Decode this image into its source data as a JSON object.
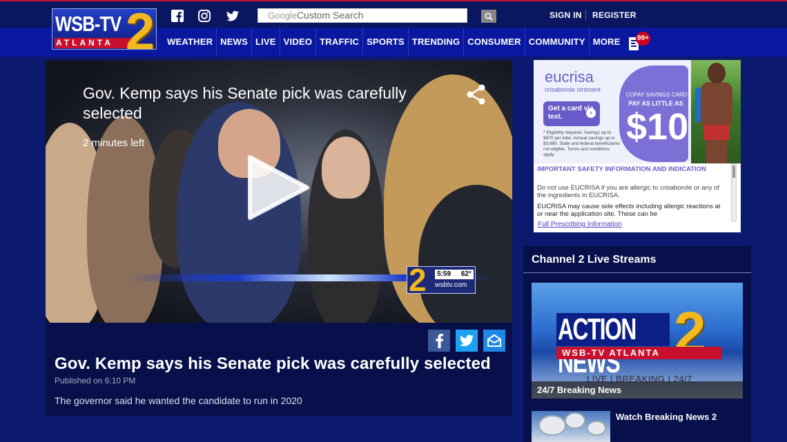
{
  "header": {
    "logo": {
      "name": "WSB-TV",
      "number": "2",
      "city": "ATLANTA"
    },
    "social": [
      "facebook-icon",
      "instagram-icon",
      "twitter-icon"
    ],
    "search": {
      "brand": "Google",
      "placeholder": "Custom Search"
    },
    "signin_label": "SIGN IN",
    "register_label": "REGISTER",
    "nav": [
      "WEATHER",
      "NEWS",
      "LIVE",
      "VIDEO",
      "TRAFFIC",
      "SPORTS",
      "TRENDING",
      "CONSUMER",
      "COMMUNITY",
      "MORE"
    ],
    "notifications_badge": "99+"
  },
  "video": {
    "title": "Gov. Kemp says his Senate pick was carefully selected",
    "time_left": "2 minutes left",
    "bug": {
      "time": "5:59",
      "temp": "62°",
      "site": "wsbtv.com"
    }
  },
  "article": {
    "title": "Gov. Kemp says his Senate pick was carefully selected",
    "published": "Published on 6:10 PM",
    "summary": "The governor said he wanted the candidate to run in 2020",
    "share": [
      "facebook-icon",
      "twitter-icon",
      "email-icon"
    ]
  },
  "ad": {
    "brand": "eucrisa",
    "sub": "crisaborole ointment",
    "card_text": "Get a card via text.",
    "fine_print": "* Eligibility required. Savings up to $970 per tube. Annual savings up to $3,880. State and federal beneficiaries not eligible. Terms and conditions apply.",
    "copay": "COPAY SAVINGS CARD",
    "pay_as": "PAY AS LITTLE AS",
    "amount": "$10",
    "isi_heading": "IMPORTANT SAFETY INFORMATION AND INDICATION",
    "isi_text": "Do not use EUCRISA if you are allergic to crisaborole or any of the ingredients in EUCRISA.",
    "isi_bold": "EUCRISA may cause side effects including allergic reactions at or near the application site. These can be",
    "link": "Full Prescribing Information"
  },
  "streams": {
    "title": "Channel 2 Live Streams",
    "hero": {
      "brand_text": "ACTION NEWS",
      "number": "2",
      "bar": "WSB-TV ATLANTA",
      "tagline": "LIVE | BREAKING | 24/7",
      "caption": "24/7 Breaking News"
    },
    "items": [
      {
        "title": "Watch Breaking News 2"
      }
    ]
  },
  "colors": {
    "page_bg": "#0b1a6e",
    "nav_bg": "#0a18a0",
    "panel_bg": "#07104a",
    "brand_gold": "#f2b820",
    "brand_red": "#c8102e"
  }
}
